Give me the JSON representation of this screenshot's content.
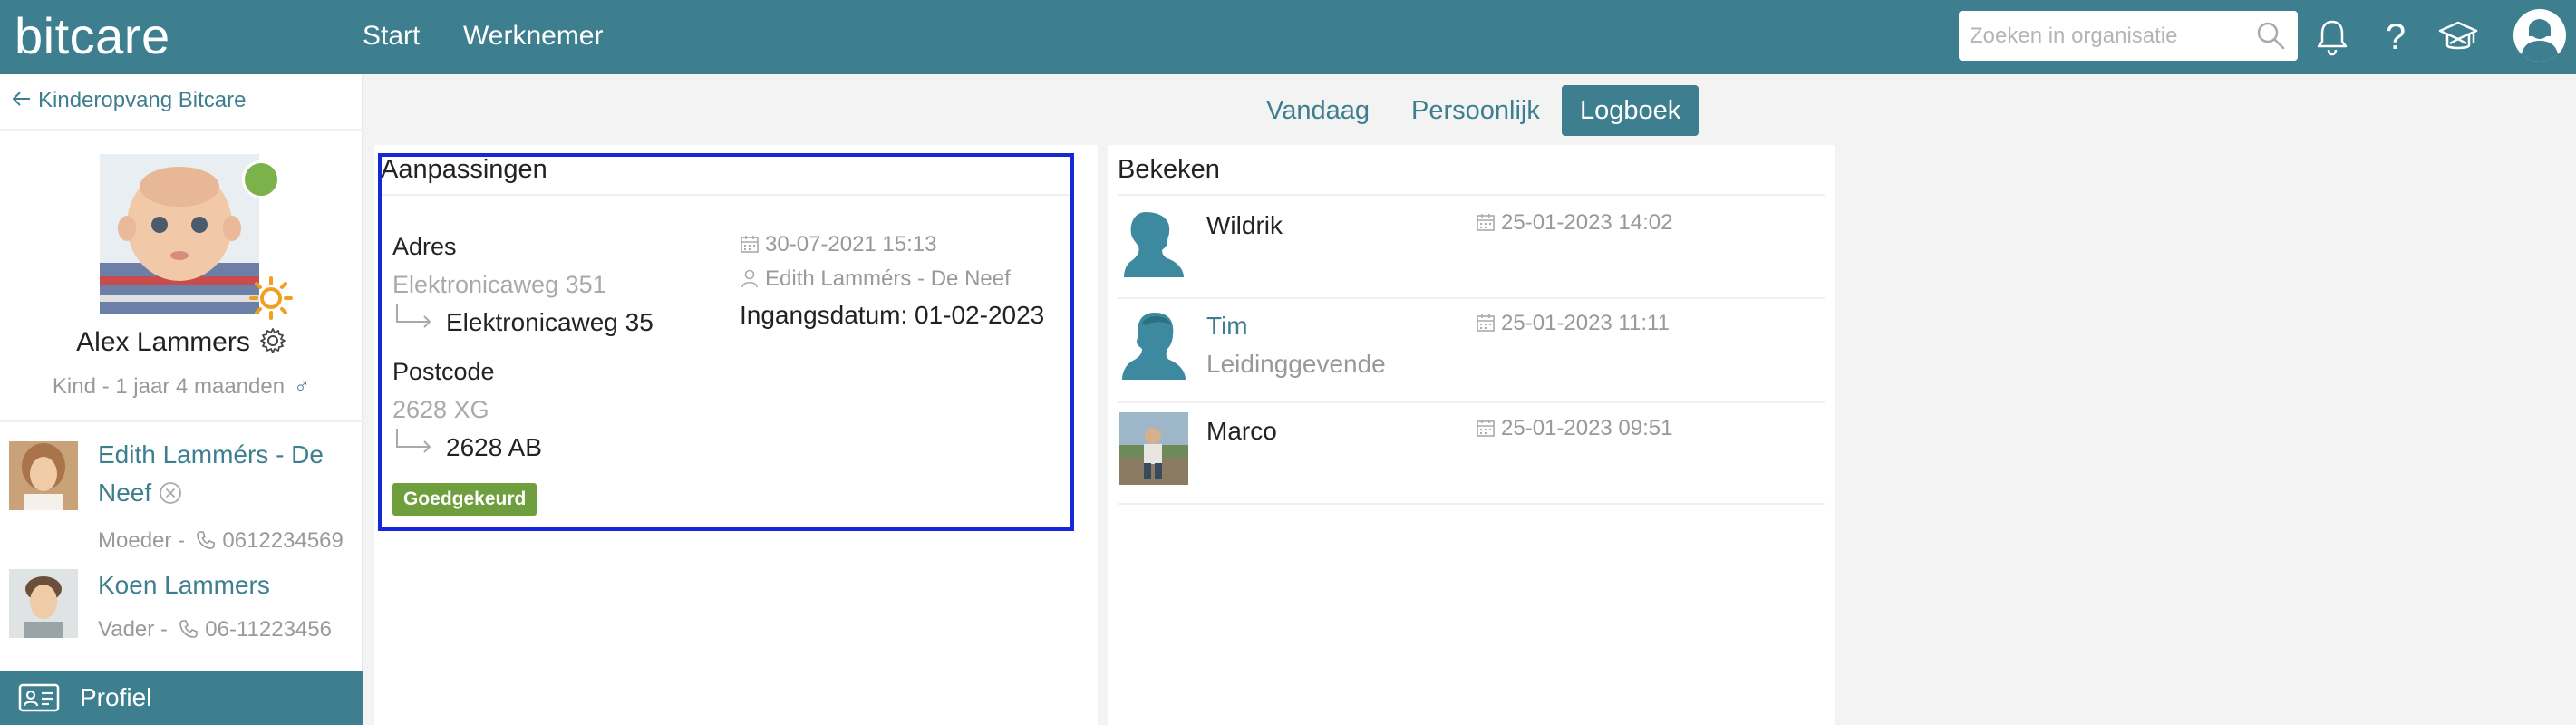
{
  "app": {
    "brand": "bitcare",
    "nav": [
      "Start",
      "Werknemer"
    ],
    "search_placeholder": "Zoeken in organisatie",
    "help_symbol": "?"
  },
  "colors": {
    "topbar": "#3d7f8f",
    "accent": "#3d7f8f",
    "status_green": "#7bb24a",
    "badge_green": "#6f9e3d",
    "highlight_border": "#1527d6"
  },
  "icons": [
    "search-icon",
    "bell-icon",
    "help-icon",
    "graduation-cap-icon",
    "user-avatar-icon",
    "arrow-left-icon",
    "gear-icon",
    "male-icon",
    "remove-icon",
    "phone-icon",
    "profile-card-icon",
    "calendar-icon",
    "person-icon",
    "sun-icon"
  ],
  "sidebar": {
    "back_link": "Kinderopvang Bitcare",
    "child": {
      "name": "Alex Lammers",
      "subtitle": "Kind - 1 jaar 4 maanden",
      "gender_symbol": "♂"
    },
    "parents": [
      {
        "name_line1": "Edith Lammérs - De",
        "name_line2": "Neef",
        "role": "Moeder -",
        "phone": "0612234569"
      },
      {
        "name": "Koen Lammers",
        "role": "Vader -",
        "phone": "06-11223456"
      }
    ],
    "profile_label": "Profiel"
  },
  "tabs": [
    {
      "label": "Vandaag",
      "active": false
    },
    {
      "label": "Persoonlijk",
      "active": false
    },
    {
      "label": "Logboek",
      "active": true
    }
  ],
  "changes": {
    "title": "Aanpassingen",
    "fields": [
      {
        "label": "Adres",
        "old": "Elektronicaweg 351",
        "new": "Elektronicaweg 35"
      },
      {
        "label": "Postcode",
        "old": "2628 XG",
        "new": "2628 AB"
      }
    ],
    "timestamp": "30-07-2021 15:13",
    "author": "Edith Lammérs - De Neef",
    "effective_date": "Ingangsdatum: 01-02-2023",
    "status": "Goedgekeurd"
  },
  "viewed": {
    "title": "Bekeken",
    "items": [
      {
        "name": "Wildrik",
        "role": "",
        "date": "25-01-2023 14:02",
        "is_link": false
      },
      {
        "name": "Tim",
        "role": "Leidinggevende",
        "date": "25-01-2023 11:11",
        "is_link": true
      },
      {
        "name": "Marco",
        "role": "",
        "date": "25-01-2023 09:51",
        "is_link": false
      }
    ]
  }
}
